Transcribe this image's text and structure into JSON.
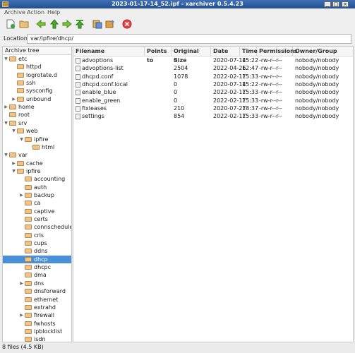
{
  "window": {
    "title": "2023-01-17-14_52.ipf - xarchiver 0.5.4.23"
  },
  "menu": [
    "Archive",
    "Action",
    "Help"
  ],
  "toolbar": {
    "icons": [
      "new-archive-icon",
      "open-archive-icon",
      "back-icon",
      "up-icon",
      "forward-icon",
      "home-icon",
      "extract-icon",
      "add-icon",
      "stop-icon"
    ]
  },
  "location": {
    "label": "Location:",
    "value": "var/ipfire/dhcp/"
  },
  "tree": {
    "header": "Archive tree",
    "items": [
      {
        "label": "etc",
        "depth": 0,
        "expander": "open"
      },
      {
        "label": "httpd",
        "depth": 1,
        "expander": ""
      },
      {
        "label": "logrotate.d",
        "depth": 1,
        "expander": ""
      },
      {
        "label": "ssh",
        "depth": 1,
        "expander": ""
      },
      {
        "label": "sysconfig",
        "depth": 1,
        "expander": ""
      },
      {
        "label": "unbound",
        "depth": 1,
        "expander": "closed"
      },
      {
        "label": "home",
        "depth": 0,
        "expander": "closed"
      },
      {
        "label": "root",
        "depth": 0,
        "expander": ""
      },
      {
        "label": "srv",
        "depth": 0,
        "expander": "open"
      },
      {
        "label": "web",
        "depth": 1,
        "expander": "open"
      },
      {
        "label": "ipfire",
        "depth": 2,
        "expander": "open"
      },
      {
        "label": "html",
        "depth": 3,
        "expander": ""
      },
      {
        "label": "var",
        "depth": 0,
        "expander": "open"
      },
      {
        "label": "cache",
        "depth": 1,
        "expander": "closed"
      },
      {
        "label": "ipfire",
        "depth": 1,
        "expander": "open"
      },
      {
        "label": "accounting",
        "depth": 2,
        "expander": ""
      },
      {
        "label": "auth",
        "depth": 2,
        "expander": ""
      },
      {
        "label": "backup",
        "depth": 2,
        "expander": "closed"
      },
      {
        "label": "ca",
        "depth": 2,
        "expander": ""
      },
      {
        "label": "captive",
        "depth": 2,
        "expander": ""
      },
      {
        "label": "certs",
        "depth": 2,
        "expander": ""
      },
      {
        "label": "connscheduler",
        "depth": 2,
        "expander": ""
      },
      {
        "label": "crls",
        "depth": 2,
        "expander": ""
      },
      {
        "label": "cups",
        "depth": 2,
        "expander": ""
      },
      {
        "label": "ddns",
        "depth": 2,
        "expander": ""
      },
      {
        "label": "dhcp",
        "depth": 2,
        "expander": "",
        "selected": true
      },
      {
        "label": "dhcpc",
        "depth": 2,
        "expander": ""
      },
      {
        "label": "dma",
        "depth": 2,
        "expander": ""
      },
      {
        "label": "dns",
        "depth": 2,
        "expander": "closed"
      },
      {
        "label": "dnsforward",
        "depth": 2,
        "expander": ""
      },
      {
        "label": "ethernet",
        "depth": 2,
        "expander": ""
      },
      {
        "label": "extrahd",
        "depth": 2,
        "expander": ""
      },
      {
        "label": "firewall",
        "depth": 2,
        "expander": "closed"
      },
      {
        "label": "fwhosts",
        "depth": 2,
        "expander": ""
      },
      {
        "label": "ipblocklist",
        "depth": 2,
        "expander": ""
      },
      {
        "label": "isdn",
        "depth": 2,
        "expander": ""
      }
    ]
  },
  "files": {
    "columns": [
      "Filename",
      "Points to",
      "Original Size",
      "Date",
      "Time",
      "Permissions",
      "Owner/Group"
    ],
    "rows": [
      [
        "advoptions",
        "",
        "0",
        "2020-07-14",
        "15:22",
        "-rw-r--r--",
        "nobody/nobody"
      ],
      [
        "advoptions-list",
        "",
        "2504",
        "2022-04-26",
        "12:47",
        "-rw-r--r--",
        "nobody/nobody"
      ],
      [
        "dhcpd.conf",
        "",
        "1078",
        "2022-02-17",
        "15:33",
        "-rw-r--r--",
        "nobody/nobody"
      ],
      [
        "dhcpd.conf.local",
        "",
        "0",
        "2020-07-14",
        "15:22",
        "-rw-r--r--",
        "nobody/nobody"
      ],
      [
        "enable_blue",
        "",
        "0",
        "2022-02-17",
        "15:33",
        "-rw-r--r--",
        "nobody/nobody"
      ],
      [
        "enable_green",
        "",
        "0",
        "2022-02-17",
        "15:33",
        "-rw-r--r--",
        "nobody/nobody"
      ],
      [
        "fixleases",
        "",
        "210",
        "2020-07-27",
        "18:37",
        "-rw-r--r--",
        "nobody/nobody"
      ],
      [
        "settings",
        "",
        "854",
        "2022-02-17",
        "15:33",
        "-rw-r--r--",
        "nobody/nobody"
      ]
    ]
  },
  "status": "8 files  (4.5 KB)"
}
